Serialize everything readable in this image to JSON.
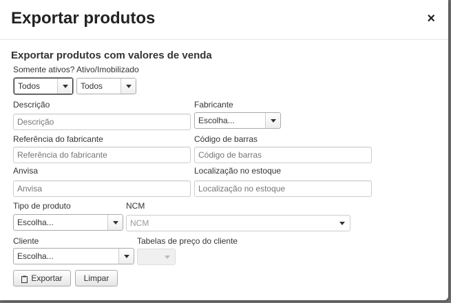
{
  "modal": {
    "title": "Exportar produtos",
    "close_icon": "×"
  },
  "form": {
    "section_title": "Exportar produtos com valores de venda",
    "somente_ativos": {
      "label": "Somente ativos?",
      "value": "Todos"
    },
    "ativo_imobilizado": {
      "label": "Ativo/Imobilizado",
      "value": "Todos"
    },
    "descricao": {
      "label": "Descrição",
      "placeholder": "Descrição"
    },
    "fabricante": {
      "label": "Fabricante",
      "value": "Escolha..."
    },
    "referencia": {
      "label": "Referência do fabricante",
      "placeholder": "Referência do fabricante"
    },
    "codigo_barras": {
      "label": "Código de barras",
      "placeholder": "Código de barras"
    },
    "anvisa": {
      "label": "Anvisa",
      "placeholder": "Anvisa"
    },
    "localizacao": {
      "label": "Localização no estoque",
      "placeholder": "Localização no estoque"
    },
    "tipo_produto": {
      "label": "Tipo de produto",
      "value": "Escolha..."
    },
    "ncm": {
      "label": "NCM",
      "placeholder": "NCM"
    },
    "cliente": {
      "label": "Cliente",
      "value": "Escolha..."
    },
    "tabelas_preco": {
      "label": "Tabelas de preço do cliente",
      "value": ""
    }
  },
  "buttons": {
    "exportar": "Exportar",
    "limpar": "Limpar"
  },
  "icons": {
    "close": "close-icon",
    "exportar": "clipboard-icon",
    "dropdown": "chevron-down-icon"
  }
}
